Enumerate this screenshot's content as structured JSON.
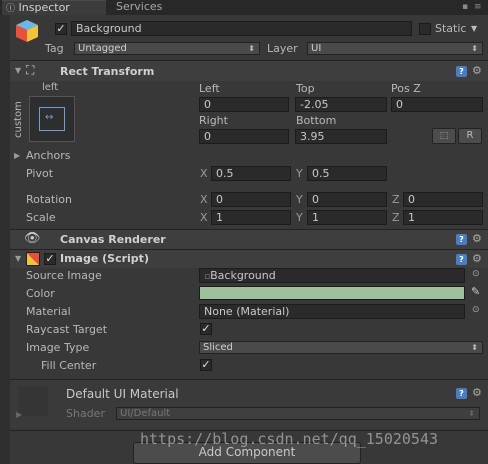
{
  "tabs": {
    "inspector": "Inspector",
    "services": "Services"
  },
  "header": {
    "name": "Background",
    "static_label": "Static",
    "tag_label": "Tag",
    "tag_value": "Untagged",
    "layer_label": "Layer",
    "layer_value": "UI"
  },
  "rect_transform": {
    "title": "Rect Transform",
    "anchor_preset_top": "left",
    "anchor_preset_side": "custom",
    "left_label": "Left",
    "left_value": "0",
    "top_label": "Top",
    "top_value": "-2.05",
    "posz_label": "Pos Z",
    "posz_value": "0",
    "right_label": "Right",
    "right_value": "0",
    "bottom_label": "Bottom",
    "bottom_value": "3.95",
    "r_button": "R",
    "anchors_label": "Anchors",
    "pivot_label": "Pivot",
    "pivot_x": "0.5",
    "pivot_y": "0.5",
    "rotation_label": "Rotation",
    "rot_x": "0",
    "rot_y": "0",
    "rot_z": "0",
    "scale_label": "Scale",
    "scale_x": "1",
    "scale_y": "1",
    "scale_z": "1",
    "x": "X",
    "y": "Y",
    "z": "Z"
  },
  "canvas_renderer": {
    "title": "Canvas Renderer"
  },
  "image": {
    "title": "Image (Script)",
    "source_label": "Source Image",
    "source_value": "Background",
    "color_label": "Color",
    "color_value": "#9cc19c",
    "material_label": "Material",
    "material_value": "None (Material)",
    "raycast_label": "Raycast Target",
    "image_type_label": "Image Type",
    "image_type_value": "Sliced",
    "fill_center_label": "Fill Center"
  },
  "material_section": {
    "title": "Default UI Material",
    "shader_label": "Shader",
    "shader_value": "UI/Default"
  },
  "add_component": "Add Component",
  "watermark": "https://blog.csdn.net/qq_15020543"
}
